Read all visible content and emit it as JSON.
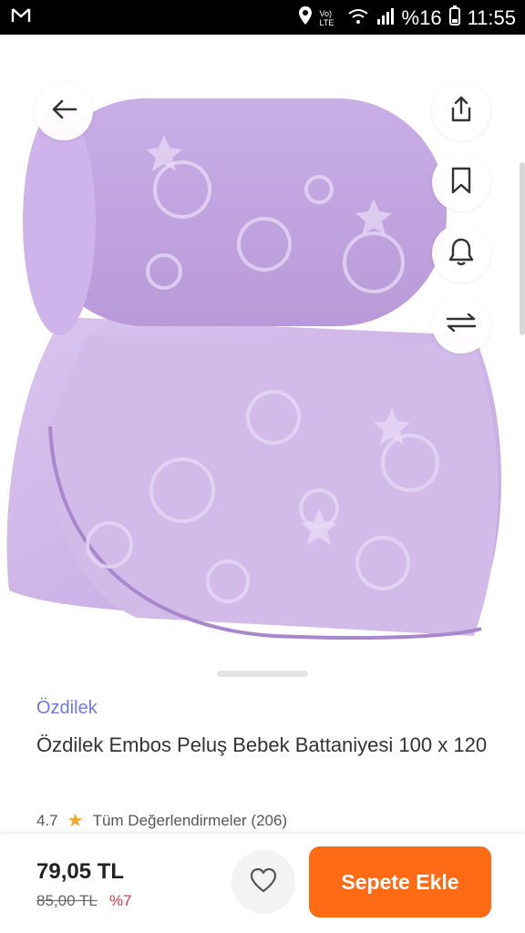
{
  "status_bar": {
    "network": "Vo) LTE",
    "battery": "%16",
    "time": "11:55",
    "icons": [
      "gmail-icon",
      "location-icon",
      "wifi-icon",
      "signal-icon",
      "battery-icon"
    ]
  },
  "product": {
    "image_alt": "lilac embossed plush baby blanket",
    "brand": "Özdilek",
    "title": "Özdilek Embos Peluş Bebek Battaniyesi 100 x 120",
    "rating": "4.7",
    "reviews_label": "Tüm Değerlendirmeler (206)"
  },
  "actions": {
    "side_icons": [
      "share-icon",
      "bookmark-icon",
      "bell-icon",
      "compare-icon"
    ],
    "back_icon": "arrow-left-icon"
  },
  "purchase": {
    "price": "79,05 TL",
    "old_price": "85,00 TL",
    "discount": "%7",
    "add_to_cart": "Sepete Ekle"
  },
  "colors": {
    "accent": "#ff6a14",
    "brand": "#6f79e3",
    "discount": "#e6323a",
    "blanket": "#cdb2e6"
  }
}
